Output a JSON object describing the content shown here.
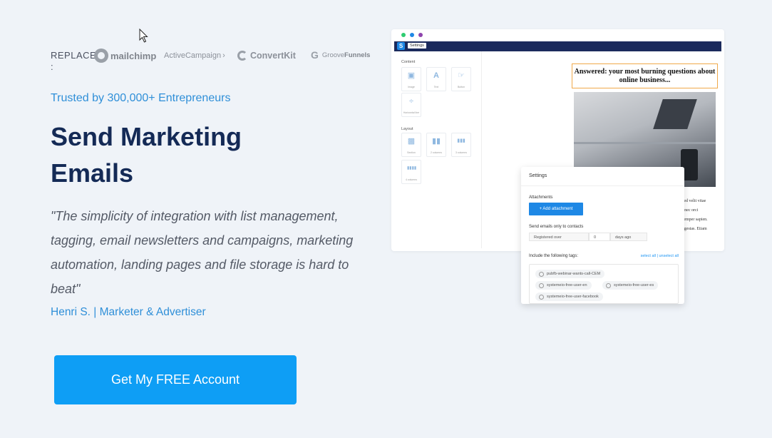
{
  "replaces": {
    "label": "REPLACES :",
    "logos": [
      {
        "name": "mailchimp",
        "text": "mailchimp"
      },
      {
        "name": "activecampaign",
        "text": "ActiveCampaign"
      },
      {
        "name": "convertkit",
        "text": "ConvertKit"
      },
      {
        "name": "groovefunnels",
        "text_light": "Groove",
        "text_bold": "Funnels"
      }
    ]
  },
  "trusted": "Trusted by 300,000+ Entrepreneurs",
  "headline": "Send Marketing Emails",
  "testimonial": {
    "quote": "\"The simplicity of integration with list management, tagging, email newsletters and campaigns, marketing automation, landing pages and file storage is hard to beat\"",
    "author": "Henri S. | Marketer & Advertiser"
  },
  "cta_label": "Get My FREE Account",
  "mock": {
    "dot_colors": [
      "#2ecc71",
      "#1e88e5",
      "#8e44ad"
    ],
    "tab_label": "Settings",
    "content_label": "Content",
    "layout_label": "Layout",
    "content_tiles": [
      "Image",
      "Text",
      "Button",
      "Horizontal line"
    ],
    "layout_tiles": [
      "Section",
      "2 columns",
      "3 columns",
      "4 columns"
    ],
    "email_headline": "Answered: your most burning questions about online business...",
    "body_text_lines": [
      "sed velit vitae",
      "t nec orci",
      "semper sapien.",
      "egestas. Etiam"
    ]
  },
  "settings": {
    "title": "Settings",
    "attachments_label": "Attachments",
    "add_attachment": "+ Add attachment",
    "send_only_label": "Send emails only to contacts",
    "registered_over": "Registered over",
    "days_value": "0",
    "days_ago": "days ago",
    "include_tags_label": "Include the following tags:",
    "select_all": "select all",
    "unselect_all": "unselect all",
    "tags": [
      "pubfb-webinar-wants-call-CEM",
      "systemeio-free-user-en",
      "systemeio-free-user-es",
      "systemeio-free-user-facebook"
    ]
  }
}
